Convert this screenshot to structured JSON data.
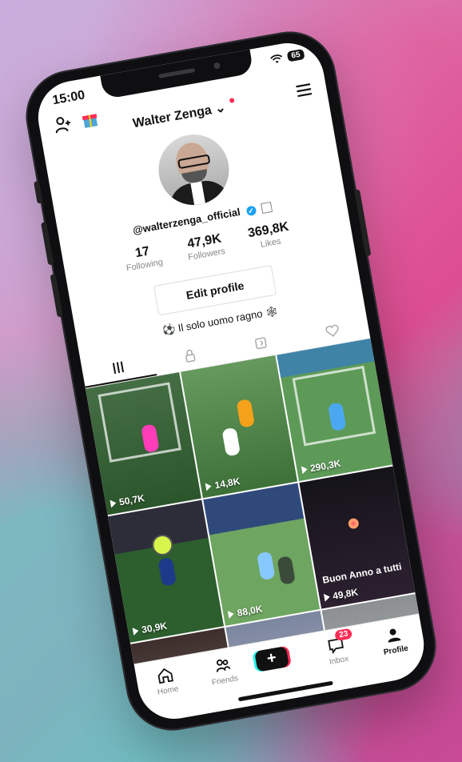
{
  "status": {
    "time": "15:00",
    "battery": "65"
  },
  "profile": {
    "display_name": "Walter Zenga",
    "username": "@walterzenga_official",
    "bio": "Il solo uomo ragno",
    "stats": [
      {
        "value": "17",
        "label": "Following"
      },
      {
        "value": "47,9K",
        "label": "Followers"
      },
      {
        "value": "369,8K",
        "label": "Likes"
      }
    ],
    "edit_label": "Edit profile"
  },
  "tabs": [
    "videos",
    "private",
    "reposts",
    "liked"
  ],
  "videos": [
    {
      "views": "50,7K"
    },
    {
      "views": "14,8K"
    },
    {
      "views": "290,3K"
    },
    {
      "views": "30,9K"
    },
    {
      "views": "88,0K"
    },
    {
      "views": "49,8K",
      "caption": "Buon Anno a tutti"
    },
    {
      "views": ""
    },
    {
      "views": ""
    },
    {
      "views": ""
    }
  ],
  "nav": {
    "home": "Home",
    "friends": "Friends",
    "inbox": "Inbox",
    "inbox_badge": "23",
    "profile": "Profile"
  }
}
